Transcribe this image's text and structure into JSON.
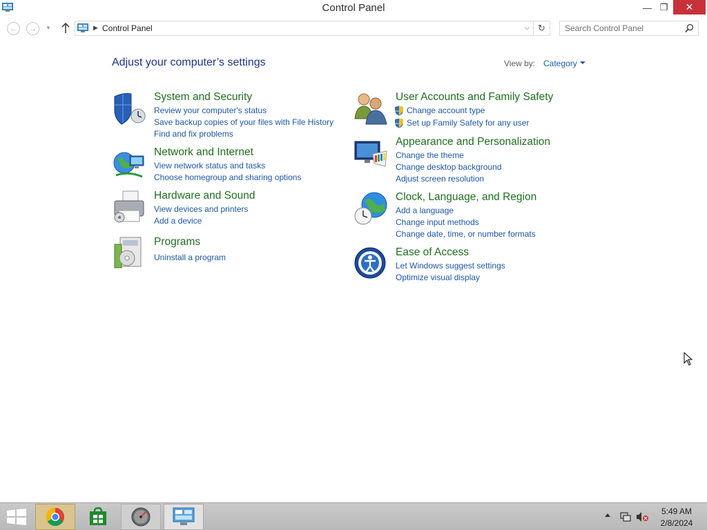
{
  "window": {
    "title": "Control Panel",
    "minimize_glyph": "—",
    "maximize_glyph": "❐",
    "close_glyph": "✕"
  },
  "address": {
    "crumb": "Control Panel",
    "search_placeholder": "Search Control Panel"
  },
  "main": {
    "page_title": "Adjust your computer’s settings",
    "view_by_label": "View by:",
    "view_by_value": "Category"
  },
  "categories": [
    {
      "heading": "System and Security",
      "icon": "system-security-shield-icon",
      "links": [
        "Review your computer's status",
        "Save backup copies of your files with File History",
        "Find and fix problems"
      ]
    },
    {
      "heading": "Network and Internet",
      "icon": "network-globe-icon",
      "links": [
        "View network status and tasks",
        "Choose homegroup and sharing options"
      ]
    },
    {
      "heading": "Hardware and Sound",
      "icon": "printer-icon",
      "links": [
        "View devices and printers",
        "Add a device"
      ]
    },
    {
      "heading": "Programs",
      "icon": "programs-disc-icon",
      "links": [
        "Uninstall a program"
      ]
    },
    {
      "heading": "User Accounts and Family Safety",
      "icon": "users-icon",
      "links": [
        "Change account type",
        "Set up Family Safety for any user"
      ]
    },
    {
      "heading": "Appearance and Personalization",
      "icon": "monitor-palette-icon",
      "links": [
        "Change the theme",
        "Change desktop background",
        "Adjust screen resolution"
      ]
    },
    {
      "heading": "Clock, Language, and Region",
      "icon": "clock-globe-icon",
      "links": [
        "Add a language",
        "Change input methods",
        "Change date, time, or number formats"
      ]
    },
    {
      "heading": "Ease of Access",
      "icon": "ease-of-access-icon",
      "links": [
        "Let Windows suggest settings",
        "Optimize visual display"
      ]
    }
  ],
  "taskbar": {
    "time": "5:49 AM",
    "date": "2/8/2024"
  },
  "colors": {
    "heading_green": "#1f6e1f",
    "link_blue": "#1c57a6",
    "title_blue": "#1e3287",
    "close_red": "#c7323a"
  }
}
